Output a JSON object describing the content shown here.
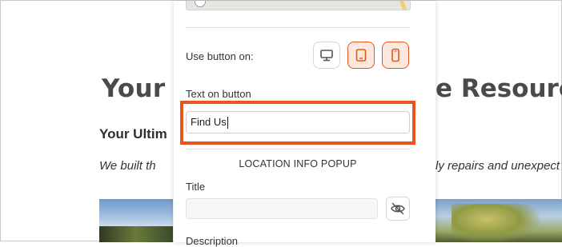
{
  "background": {
    "heading_left": "Your",
    "heading_right": "e Resourc",
    "subheading": "Your Ultim",
    "body_left": "We built th",
    "body_right": "ly repairs and unexpect"
  },
  "panel": {
    "use_button_label": "Use button on:",
    "devices": [
      {
        "name": "desktop",
        "icon": "desktop-icon",
        "selected": false
      },
      {
        "name": "tablet",
        "icon": "tablet-icon",
        "selected": true
      },
      {
        "name": "mobile",
        "icon": "mobile-icon",
        "selected": true
      }
    ],
    "text_on_button_label": "Text on button",
    "text_on_button_value": "Find Us",
    "section_title": "LOCATION INFO POPUP",
    "title_label": "Title",
    "title_value": "",
    "description_label_partial": "Description"
  },
  "colors": {
    "accent": "#e9541c",
    "selected_bg": "#fde8de"
  }
}
